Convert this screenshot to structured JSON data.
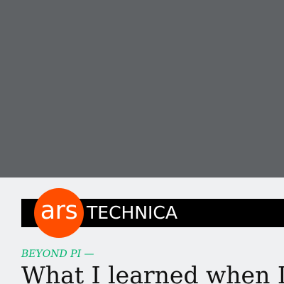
{
  "hero": {
    "image_color": "#5f6265"
  },
  "masthead": {
    "logo_ars": "ars",
    "logo_technica": "TECHNICA",
    "brand_color": "#ff4e00"
  },
  "article": {
    "kicker": "BEYOND PI —",
    "kicker_color": "#00b46e",
    "headline": "What I learned when I"
  }
}
